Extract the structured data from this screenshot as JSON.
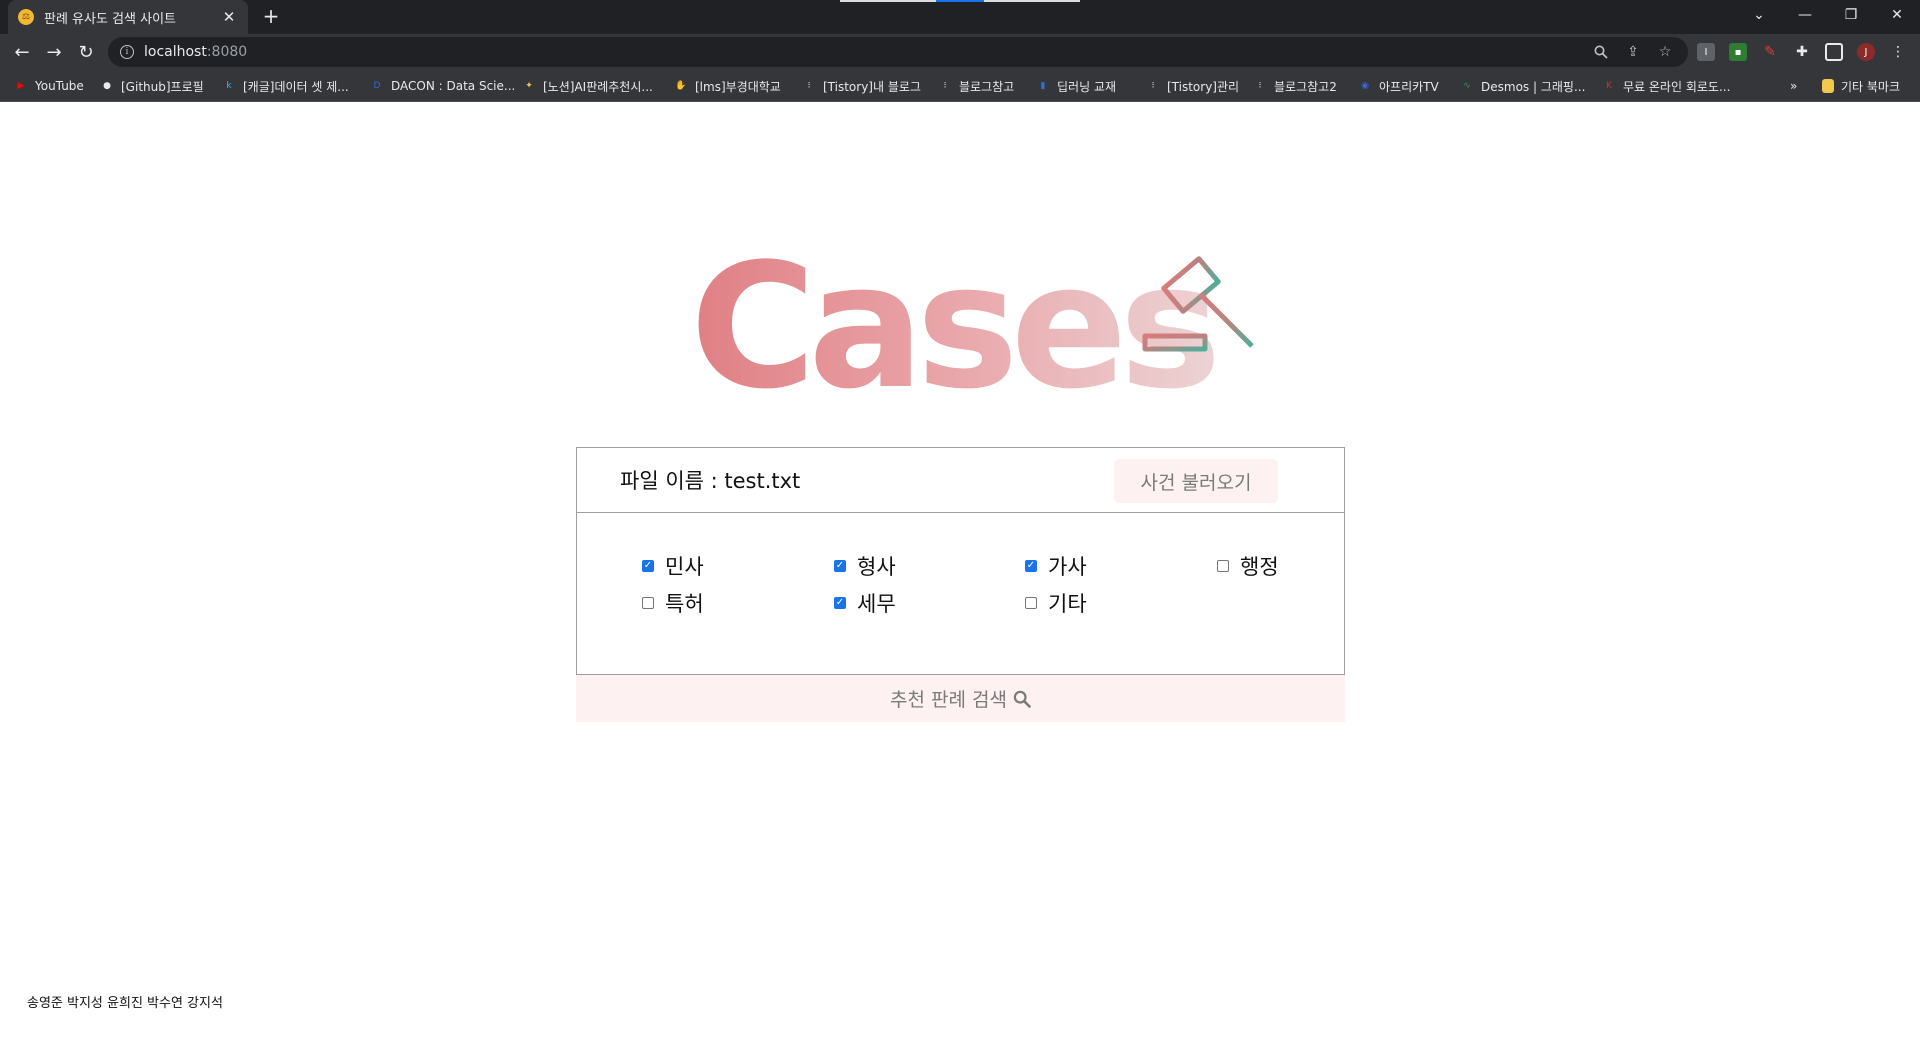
{
  "browser": {
    "tab_title": "판례 유사도 검색 사이트",
    "tab_favicon": "⚖",
    "url_host": "localhost",
    "url_port": ":8080",
    "bookmarks": [
      {
        "label": "YouTube",
        "icon": "youtube-icon",
        "color": "#ff0000"
      },
      {
        "label": "[Github]프로필",
        "icon": "github-icon",
        "color": "#e8eaed"
      },
      {
        "label": "[캐글]데이터 셋 제...",
        "icon": "kaggle-icon",
        "color": "#20beff"
      },
      {
        "label": "DACON : Data Scie...",
        "icon": "dacon-icon",
        "color": "#3a64d8"
      },
      {
        "label": "[노션]AI판례추천시...",
        "icon": "lightbulb-icon",
        "color": "#f5c542"
      },
      {
        "label": "[lms]부경대학교",
        "icon": "hand-icon",
        "color": "#6fb3ff"
      },
      {
        "label": "[Tistory]내 블로그",
        "icon": "tistory-icon",
        "color": "#e8eaed"
      },
      {
        "label": "블로그참고",
        "icon": "tistory-icon",
        "color": "#e8eaed"
      },
      {
        "label": "딥러닝 교재",
        "icon": "book-icon",
        "color": "#2f6fd6"
      },
      {
        "label": "[Tistory]관리",
        "icon": "tistory-icon",
        "color": "#e8eaed"
      },
      {
        "label": "블로그참고2",
        "icon": "tistory-icon",
        "color": "#e8eaed"
      },
      {
        "label": "아프리카TV",
        "icon": "afreecatv-icon",
        "color": "#3a64d8"
      },
      {
        "label": "Desmos | 그래핑...",
        "icon": "desmos-icon",
        "color": "#2e9d49"
      },
      {
        "label": "무료 온라인 회로도...",
        "icon": "circuit-icon",
        "color": "#d32f2f"
      }
    ],
    "more_bookmarks": "»",
    "other_bookmarks": "기타 북마크",
    "profile_initial": "J"
  },
  "logo": {
    "text": "Cases",
    "icon": "gavel-icon"
  },
  "form": {
    "file_label": "파일 이름 : ",
    "file_name": "test.txt",
    "load_button": "사건 불러오기",
    "categories": [
      {
        "label": "민사",
        "checked": true
      },
      {
        "label": "형사",
        "checked": true
      },
      {
        "label": "가사",
        "checked": true
      },
      {
        "label": "행정",
        "checked": false
      },
      {
        "label": "특허",
        "checked": false
      },
      {
        "label": "세무",
        "checked": true
      },
      {
        "label": "기타",
        "checked": false
      }
    ],
    "search_button": "추천 판례 검색"
  },
  "footer": {
    "names": "송영준 박지성 윤희진 박수연 강지석"
  },
  "colors": {
    "checkbox_on": "#1a73e8",
    "button_bg": "#fdf1f1",
    "logo_gradient": [
      "#e07f84",
      "#e9a6aa",
      "#ecd3d4"
    ]
  }
}
